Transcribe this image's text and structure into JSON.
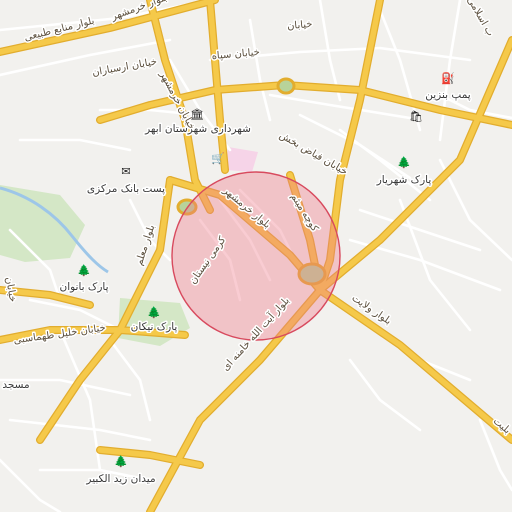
{
  "colors": {
    "background": "#f2f1ee",
    "major_road": "#f5c94a",
    "major_road_casing": "#e2ad2e",
    "minor_road": "#ffffff",
    "park": "#d4e7c6",
    "water": "#9dc6e8",
    "highlight_fill": "#f07a8a",
    "highlight_stroke": "#d84a5e",
    "roundabout": "#b8d39a",
    "label_text": "#5a4e3c"
  },
  "highlight": {
    "label": ""
  },
  "streets": {
    "manabe_tabiei": "بلوار منابع طبیعی",
    "khorramshahr_top": "بلوار خرمشهر",
    "arsbaran": "خیابان ارسباران",
    "sepah": "خیابان سپاه",
    "khorramshahr_middle": "خیابان خرمشهر",
    "bakhshi": "خیابان فیاض بخش",
    "khorramshahr_blvd": "بلوار خرمشهر",
    "koohe_meysam": "کوچه میثم",
    "karami_neyestan": "کرمی نیستان",
    "moallem": "بلوار معلم",
    "velayat": "بلوار ولایت",
    "ayatollah_khamenei": "بلوار آیت الله خامنه ای",
    "khalil_tahmasbi": "خیابان خلیل طهماسبی",
    "islami_top_right": "ب اسلامی",
    "right_edge_partial": "بلیت",
    "left_edge_partial": "خیابان",
    "center_top": "خیابان"
  },
  "pois": [
    {
      "name": "shahrdari",
      "label": "شهرداری شهرستان ابهر",
      "icon": "bank-icon",
      "glyph": "🏛"
    },
    {
      "name": "post-bank",
      "label": "پست بانک مرکزی",
      "icon": "mail-icon",
      "glyph": "✉"
    },
    {
      "name": "park-banoan",
      "label": "پارک بانوان",
      "icon": "tree-icon",
      "glyph": "🌲"
    },
    {
      "name": "park-nikan",
      "label": "پارک نیکان",
      "icon": "tree-icon",
      "glyph": "🌲"
    },
    {
      "name": "park-shahriar",
      "label": "پارک شهریار",
      "icon": "tree-icon",
      "glyph": "🌲"
    },
    {
      "name": "pomp-benzin",
      "label": "پمپ بنزین",
      "icon": "fuel-pump-icon",
      "glyph": "⛽"
    },
    {
      "name": "meydan-zeid",
      "label": "میدان زید الکبیر",
      "icon": "tree-icon",
      "glyph": "🌲"
    },
    {
      "name": "masjed",
      "label": "مسجد",
      "icon": "mosque-icon",
      "glyph": ""
    }
  ]
}
